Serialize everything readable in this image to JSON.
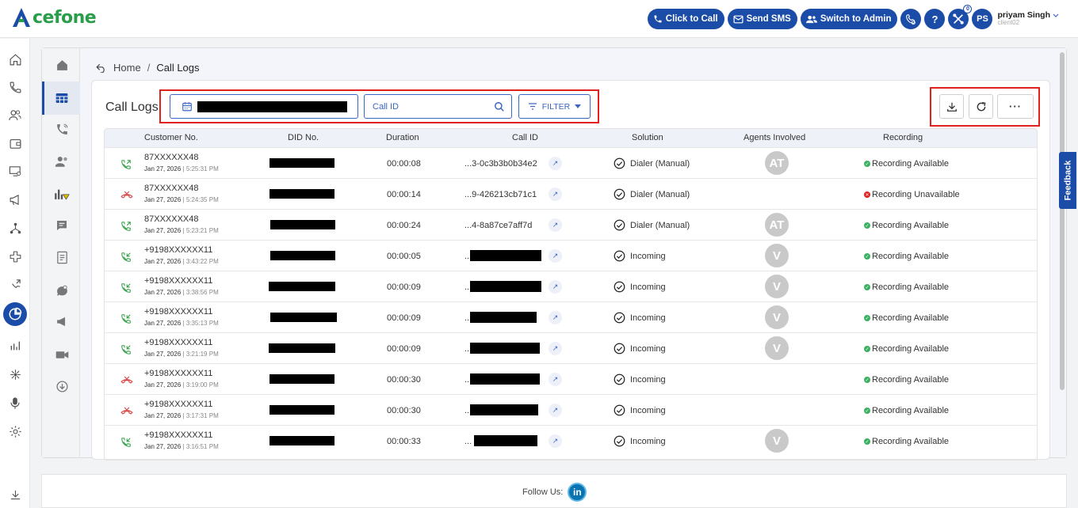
{
  "app": {
    "logo_text": "cefone"
  },
  "topbar": {
    "click_to_call": "Click to Call",
    "send_sms": "Send SMS",
    "switch_to_admin": "Switch to Admin",
    "help": "?",
    "badge_count": "0",
    "avatar_initials": "PS",
    "user_name": "priyam Singh",
    "user_sub": "client02"
  },
  "breadcrumb": {
    "home": "Home",
    "separator": "/",
    "current": "Call Logs"
  },
  "card": {
    "title": "Call Logs",
    "callid_placeholder": "Call ID",
    "filter_label": "FILTER",
    "more_label": "···"
  },
  "table": {
    "headers": {
      "customer": "Customer No.",
      "did": "DID No.",
      "duration": "Duration",
      "callid": "Call ID",
      "solution": "Solution",
      "agents": "Agents Involved",
      "recording": "Recording"
    },
    "rows": [
      {
        "type": "answered",
        "customer": "87XXXXXX48",
        "date": "Jan 27, 2026",
        "time": "5:25:31 PM",
        "duration": "00:00:08",
        "callid": "...3-0c3b3b0b34e2",
        "solution": "Dialer (Manual)",
        "agent": "AT",
        "recording": "Recording Available",
        "rec_ok": true
      },
      {
        "type": "missed",
        "customer": "87XXXXXX48",
        "date": "Jan 27, 2026",
        "time": "5:24:35 PM",
        "duration": "00:00:14",
        "callid": "...9-426213cb71c1",
        "solution": "Dialer (Manual)",
        "agent": "",
        "recording": "Recording Unavailable",
        "rec_ok": false
      },
      {
        "type": "answered",
        "customer": "87XXXXXX48",
        "date": "Jan 27, 2026",
        "time": "5:23:21 PM",
        "duration": "00:00:24",
        "callid": "...4-8a87ce7aff7d",
        "solution": "Dialer (Manual)",
        "agent": "AT",
        "recording": "Recording Available",
        "rec_ok": true
      },
      {
        "type": "incoming",
        "customer": "+9198XXXXXX11",
        "date": "Jan 27, 2026",
        "time": "3:43:22 PM",
        "duration": "00:00:05",
        "callid": "",
        "solution": "Incoming",
        "agent": "V",
        "recording": "Recording Available",
        "rec_ok": true
      },
      {
        "type": "incoming",
        "customer": "+9198XXXXXX11",
        "date": "Jan 27, 2026",
        "time": "3:38:56 PM",
        "duration": "00:00:09",
        "callid": "",
        "solution": "Incoming",
        "agent": "V",
        "recording": "Recording Available",
        "rec_ok": true
      },
      {
        "type": "incoming",
        "customer": "+9198XXXXXX11",
        "date": "Jan 27, 2026",
        "time": "3:35:13 PM",
        "duration": "00:00:09",
        "callid": "",
        "solution": "Incoming",
        "agent": "V",
        "recording": "Recording Available",
        "rec_ok": true
      },
      {
        "type": "incoming",
        "customer": "+9198XXXXXX11",
        "date": "Jan 27, 2026",
        "time": "3:21:19 PM",
        "duration": "00:00:09",
        "callid": "",
        "solution": "Incoming",
        "agent": "V",
        "recording": "Recording Available",
        "rec_ok": true
      },
      {
        "type": "missed",
        "customer": "+9198XXXXXX11",
        "date": "Jan 27, 2026",
        "time": "3:19:00 PM",
        "duration": "00:00:30",
        "callid": "",
        "solution": "Incoming",
        "agent": "",
        "recording": "Recording Available",
        "rec_ok": true
      },
      {
        "type": "missed",
        "customer": "+9198XXXXXX11",
        "date": "Jan 27, 2026",
        "time": "3:17:31 PM",
        "duration": "00:00:30",
        "callid": "",
        "solution": "Incoming",
        "agent": "",
        "recording": "Recording Available",
        "rec_ok": true
      },
      {
        "type": "incoming",
        "customer": "+9198XXXXXX11",
        "date": "Jan 27, 2026",
        "time": "3:16:51 PM",
        "duration": "00:00:33",
        "callid": "",
        "solution": "Incoming",
        "agent": "V",
        "recording": "Recording Available",
        "rec_ok": true
      }
    ]
  },
  "feedback_label": "Feedback",
  "footer": {
    "follow_us": "Follow Us:",
    "linkedin": "in"
  },
  "colors": {
    "brand_blue": "#1a4ca8",
    "brand_green": "#2a9d4a",
    "highlight_red": "#e0211d"
  }
}
